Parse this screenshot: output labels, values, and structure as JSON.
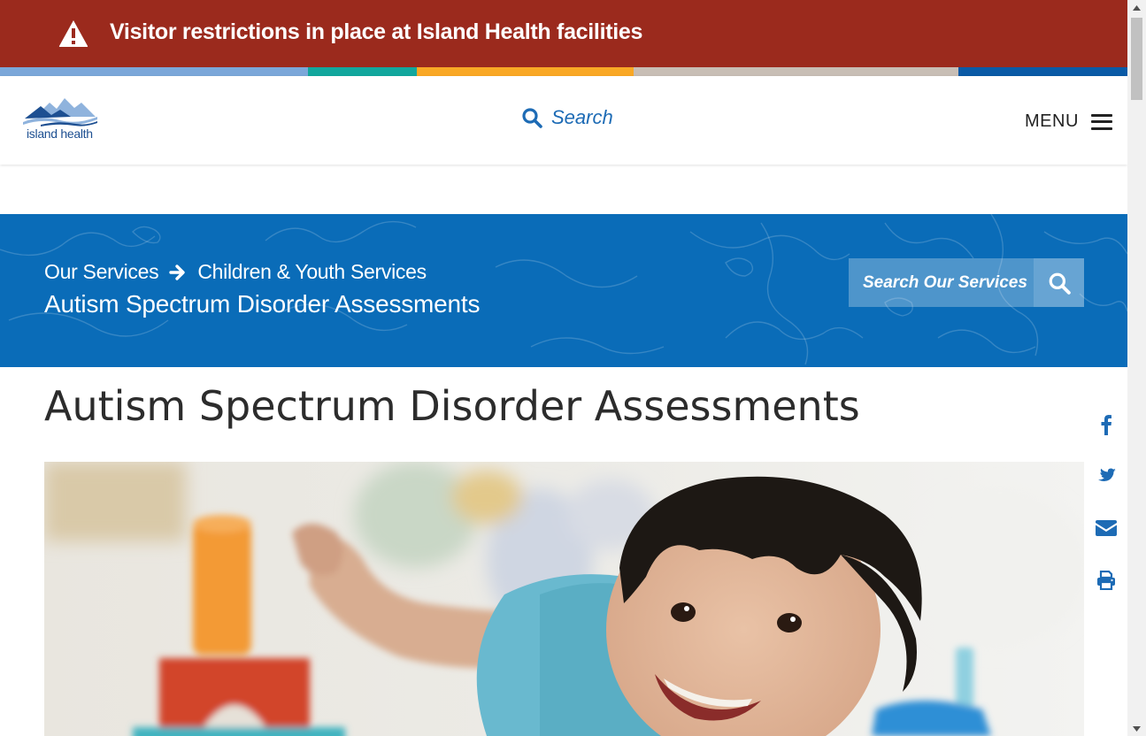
{
  "alert": {
    "text": "Visitor restrictions in place at Island Health facilities",
    "icon": "warning-triangle-icon",
    "background": "#9b2a1d"
  },
  "stripe_colors": [
    "#7ba7d9",
    "#12a79d",
    "#f9a825",
    "#c8beb5",
    "#0a5aa6"
  ],
  "header": {
    "logo_text": "island health",
    "search_label": "Search",
    "menu_label": "MENU"
  },
  "banner": {
    "breadcrumb": [
      "Our Services",
      "Children & Youth Services"
    ],
    "title": "Autism Spectrum Disorder Assessments",
    "search_placeholder": "Search Our Services",
    "background": "#0a6cb8"
  },
  "page": {
    "title": "Autism Spectrum Disorder Assessments"
  },
  "share_icons": [
    "facebook-icon",
    "twitter-icon",
    "email-icon",
    "print-icon"
  ],
  "colors": {
    "accent": "#1d6bb5",
    "text": "#2c2c2c"
  }
}
